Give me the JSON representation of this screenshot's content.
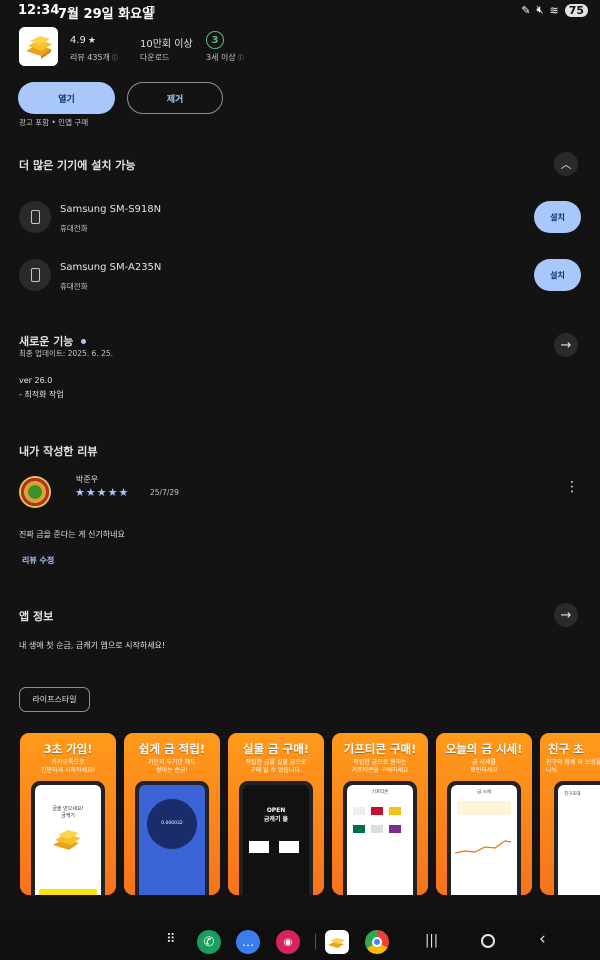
{
  "status": {
    "time": "12:34",
    "date": "7월 29일 화요일",
    "battery": "75"
  },
  "app": {
    "rating": "4.9",
    "reviews": "리뷰 435개",
    "downloads_value": "10만회 이상",
    "downloads_label": "다운로드",
    "age_value": "3",
    "age_label": "3세 이상"
  },
  "actions": {
    "open_label": "열기",
    "remove_label": "제거",
    "notice": "광고 포함 • 인앱 구매"
  },
  "more_devices": {
    "title": "더 많은 기기에 설치 가능",
    "devices": [
      {
        "name": "Samsung SM-S918N",
        "type": "휴대전화",
        "button": "설치"
      },
      {
        "name": "Samsung SM-A235N",
        "type": "휴대전화",
        "button": "설치"
      }
    ]
  },
  "whats_new": {
    "title": "새로운 기능",
    "updated": "최종 업데이트: 2025. 6. 25.",
    "version": "ver 26.0",
    "note": "- 최적화 작업"
  },
  "my_review": {
    "title": "내가 작성한 리뷰",
    "author": "박준우",
    "stars": "★★★★★",
    "date": "25/7/29",
    "text": "진짜 금을 준다는 게 신기하네요",
    "edit_label": "리뷰 수정"
  },
  "app_info": {
    "title": "앱 정보",
    "description": "내 생애 첫 순금, 금캐기 앱으로 시작하세요!",
    "category": "라이프스타일"
  },
  "screenshots": [
    {
      "title": "3초 가입!",
      "sub": "카카오톡으로\n간편하게 시작하세요!",
      "inner": "금을 만으세요!\n금캐기"
    },
    {
      "title": "쉽게 금 적립!",
      "sub": "가만히 두기만 해도\n쌓이는 순금!",
      "inner": "0.000032"
    },
    {
      "title": "실물 금 구매!",
      "sub": "적립한 금을 실물 금으로\n구매 할 수 있습니다.",
      "inner": "OPEN\n금캐기 몰"
    },
    {
      "title": "기프티콘 구매!",
      "sub": "적립한 금으로 원하는\n기프티콘을 구매하세요",
      "inner": "기프티콘"
    },
    {
      "title": "오늘의 금 시세!",
      "sub": "금 시세를\n확인하세요",
      "inner": "금 시세"
    },
    {
      "title": "친구 초",
      "sub": "친구와 함께 하\n보상을 나눠",
      "inner": "친구초대"
    }
  ],
  "colors": {
    "accent": "#a8c7fa",
    "background": "#131314",
    "banner": "#f7731c",
    "age_green": "#5bb974"
  }
}
